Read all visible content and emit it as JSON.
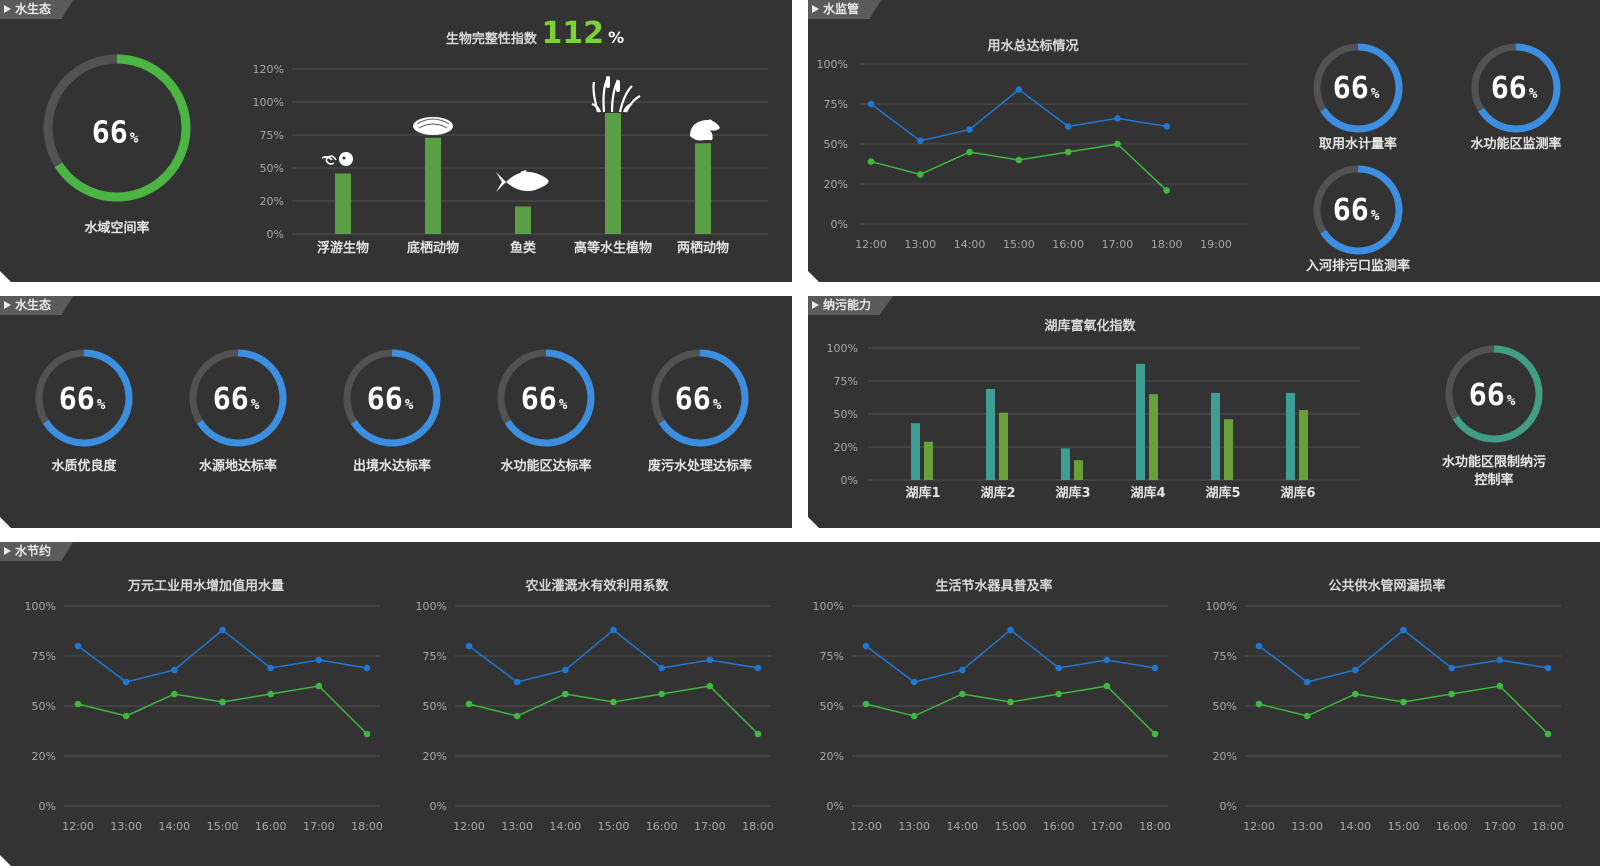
{
  "colors": {
    "panel": "#333333",
    "grid": "#525252",
    "track": "#525252",
    "green": "#4bb543",
    "blue": "#3c8fe0",
    "line_blue": "#1f77d2",
    "line_green": "#3fb83f",
    "teal": "#3f9e93",
    "olive": "#6aa03a",
    "bar": "#5a9e45",
    "index_green": "#7bd13a"
  },
  "panels": {
    "p1": {
      "tag": "水生态"
    },
    "p2": {
      "tag": "水监管"
    },
    "p3": {
      "tag": "水生态"
    },
    "p4": {
      "tag": "纳污能力"
    },
    "p5": {
      "tag": "水节约"
    }
  },
  "water_area": {
    "value": "66",
    "unit": "%",
    "label": "水域空间率",
    "fraction": 0.66
  },
  "bio_index": {
    "title": "生物完整性指数",
    "value": "112",
    "unit": "%"
  },
  "icons": [
    "jellyfish-icon",
    "clam-icon",
    "fish-icon",
    "reed-icon",
    "frog-icon"
  ],
  "chart_data": [
    {
      "id": "bio",
      "type": "bar",
      "categories": [
        "浮游生物",
        "底栖动物",
        "鱼类",
        "高等水生植物",
        "两栖动物"
      ],
      "values": [
        44,
        70,
        20,
        88,
        66
      ],
      "yticks": [
        "120%",
        "100%",
        "75%",
        "50%",
        "20%",
        "0%"
      ],
      "ylim": [
        0,
        120
      ]
    },
    {
      "id": "usage",
      "type": "line",
      "title": "用水总达标情况",
      "x": [
        "12:00",
        "13:00",
        "14:00",
        "15:00",
        "16:00",
        "17:00",
        "18:00",
        "19:00"
      ],
      "yticks": [
        "100%",
        "75%",
        "50%",
        "20%",
        "0%"
      ],
      "series": [
        {
          "values": [
            75,
            52,
            59,
            84,
            61,
            66,
            61
          ]
        },
        {
          "values": [
            39,
            31,
            45,
            40,
            45,
            50,
            21
          ]
        }
      ]
    },
    {
      "id": "eutro",
      "type": "bar",
      "title": "湖库富氧化指数",
      "categories": [
        "湖库1",
        "湖库2",
        "湖库3",
        "湖库4",
        "湖库5",
        "湖库6"
      ],
      "yticks": [
        "100%",
        "75%",
        "50%",
        "20%",
        "0%"
      ],
      "series": [
        {
          "values": [
            43,
            69,
            24,
            88,
            66,
            66
          ]
        },
        {
          "values": [
            29,
            51,
            15,
            65,
            46,
            53
          ]
        }
      ]
    },
    {
      "id": "s1",
      "type": "line",
      "title": "万元工业用水增加值用水量",
      "x": [
        "12:00",
        "13:00",
        "14:00",
        "15:00",
        "16:00",
        "17:00",
        "18:00"
      ],
      "yticks": [
        "100%",
        "75%",
        "50%",
        "20%",
        "0%"
      ],
      "series": [
        {
          "values": [
            80,
            62,
            68,
            88,
            69,
            73,
            69
          ]
        },
        {
          "values": [
            51,
            45,
            56,
            52,
            56,
            60,
            36
          ]
        }
      ]
    },
    {
      "id": "s2",
      "type": "line",
      "title": "农业灌溉水有效利用系数",
      "x": [
        "12:00",
        "13:00",
        "14:00",
        "15:00",
        "16:00",
        "17:00",
        "18:00"
      ],
      "yticks": [
        "100%",
        "75%",
        "50%",
        "20%",
        "0%"
      ],
      "series": [
        {
          "values": [
            80,
            62,
            68,
            88,
            69,
            73,
            69
          ]
        },
        {
          "values": [
            51,
            45,
            56,
            52,
            56,
            60,
            36
          ]
        }
      ]
    },
    {
      "id": "s3",
      "type": "line",
      "title": "生活节水器具普及率",
      "x": [
        "12:00",
        "13:00",
        "14:00",
        "15:00",
        "16:00",
        "17:00",
        "18:00"
      ],
      "yticks": [
        "100%",
        "75%",
        "50%",
        "20%",
        "0%"
      ],
      "series": [
        {
          "values": [
            80,
            62,
            68,
            88,
            69,
            73,
            69
          ]
        },
        {
          "values": [
            51,
            45,
            56,
            52,
            56,
            60,
            36
          ]
        }
      ]
    },
    {
      "id": "s4",
      "type": "line",
      "title": "公共供水管网漏损率",
      "x": [
        "12:00",
        "13:00",
        "14:00",
        "15:00",
        "16:00",
        "17:00",
        "18:00"
      ],
      "yticks": [
        "100%",
        "75%",
        "50%",
        "20%",
        "0%"
      ],
      "series": [
        {
          "values": [
            80,
            62,
            68,
            88,
            69,
            73,
            69
          ]
        },
        {
          "values": [
            51,
            45,
            56,
            52,
            56,
            60,
            36
          ]
        }
      ]
    }
  ],
  "monitor_gauges": [
    {
      "value": "66",
      "unit": "%",
      "label": "取用水计量率",
      "fraction": 0.66
    },
    {
      "value": "66",
      "unit": "%",
      "label": "水功能区监测率",
      "fraction": 0.66
    },
    {
      "value": "66",
      "unit": "%",
      "label": "入河排污口监测率",
      "fraction": 0.66
    }
  ],
  "quality_gauges": [
    {
      "value": "66",
      "unit": "%",
      "label": "水质优良度",
      "fraction": 0.66
    },
    {
      "value": "66",
      "unit": "%",
      "label": "水源地达标率",
      "fraction": 0.66
    },
    {
      "value": "66",
      "unit": "%",
      "label": "出境水达标率",
      "fraction": 0.66
    },
    {
      "value": "66",
      "unit": "%",
      "label": "水功能区达标率",
      "fraction": 0.66
    },
    {
      "value": "66",
      "unit": "%",
      "label": "废污水处理达标率",
      "fraction": 0.66
    }
  ],
  "capacity_gauge": {
    "value": "66",
    "unit": "%",
    "label_line1": "水功能区限制纳污",
    "label_line2": "控制率",
    "fraction": 0.66
  }
}
